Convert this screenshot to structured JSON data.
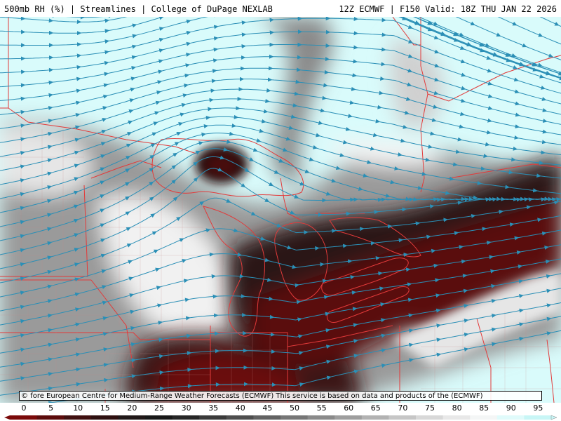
{
  "header": {
    "left_title": "500mb RH (%) | Streamlines | College of DuPage NEXLAB",
    "right_title": "12Z ECMWF | F150 Valid: 18Z THU JAN 22 2026"
  },
  "credit": "© fore European Centre for Medium-Range Weather Forecasts (ECMWF)  This service is based on data and products of the (ECMWF)",
  "colorbar": {
    "ticks": [
      "0",
      "5",
      "10",
      "15",
      "20",
      "25",
      "30",
      "35",
      "40",
      "45",
      "50",
      "55",
      "60",
      "65",
      "70",
      "75",
      "80",
      "85",
      "90",
      "95"
    ],
    "colors": [
      "#7a0a0a",
      "#5c0c0c",
      "#401010",
      "#2e1010",
      "#201818",
      "#181818",
      "#262626",
      "#3a3a3a",
      "#4e4e4e",
      "#626262",
      "#767676",
      "#8a8a8a",
      "#9e9e9e",
      "#b2b2b2",
      "#c6c6c6",
      "#d8d8d8",
      "#e8e8e8",
      "#f4f6f6",
      "#e0fbfb",
      "#c8f6f6"
    ]
  },
  "colors": {
    "streamline": "#2b8fb6",
    "borders": "#e23a3a",
    "moist": "#d9fbfb",
    "dry": "#5a0f0f"
  }
}
